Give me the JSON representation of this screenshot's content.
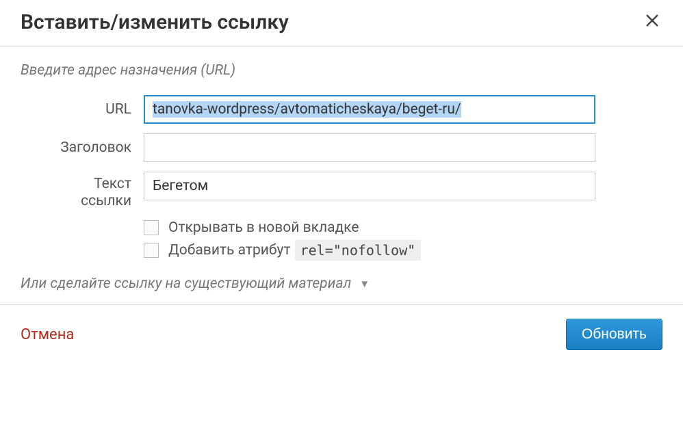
{
  "dialog": {
    "title": "Вставить/изменить ссылку",
    "hint": "Введите адрес назначения (URL)",
    "labels": {
      "url": "URL",
      "title": "Заголовок",
      "link_text": "Текст\nссылки"
    },
    "fields": {
      "url_value": "tanovka-wordpress/avtomaticheskaya/beget-ru/",
      "title_value": "",
      "link_text_value": "Бегетом"
    },
    "options": {
      "new_tab": "Открывать в новой вкладке",
      "nofollow_prefix": "Добавить атрибут",
      "nofollow_code": "rel=\"nofollow\""
    },
    "existing": "Или сделайте ссылку на существующий материал",
    "footer": {
      "cancel": "Отмена",
      "submit": "Обновить"
    }
  }
}
